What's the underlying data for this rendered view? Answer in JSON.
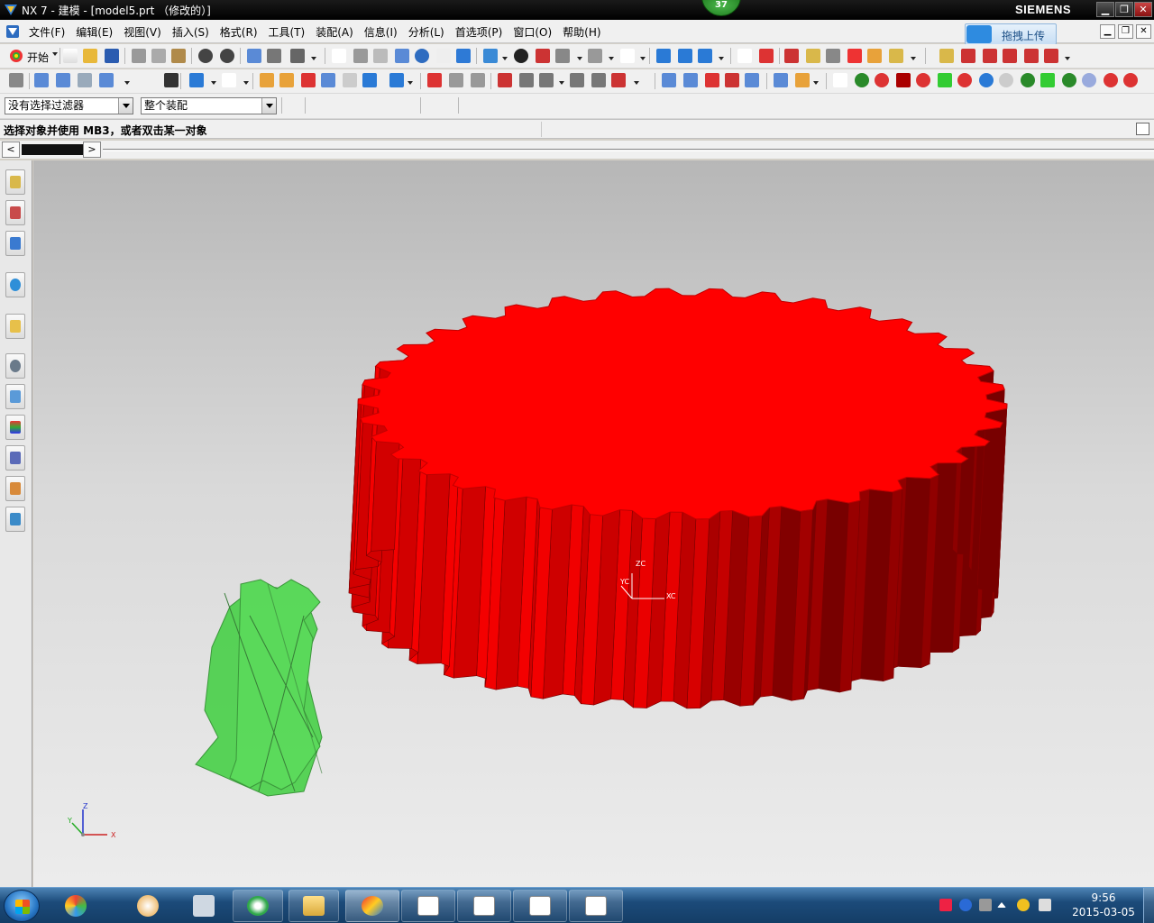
{
  "window": {
    "title": "NX 7 - 建模 - [model5.prt （修改的）]",
    "brand": "SIEMENS",
    "badge": "37",
    "controls": {
      "minimize": "▁",
      "restore": "❐",
      "close": "✕"
    }
  },
  "menubar": {
    "items": [
      "文件(F)",
      "编辑(E)",
      "视图(V)",
      "插入(S)",
      "格式(R)",
      "工具(T)",
      "装配(A)",
      "信息(I)",
      "分析(L)",
      "首选项(P)",
      "窗口(O)",
      "帮助(H)"
    ],
    "upload_label": "拖拽上传"
  },
  "toolbar": {
    "start_label": "开始",
    "start_icon": "start-icon"
  },
  "filters": {
    "type_filter": "没有选择过滤器",
    "scope_filter": "整个装配"
  },
  "prompt": {
    "text": "选择对象并使用 MB3，或者双击某一对象"
  },
  "viewport": {
    "gear_color": "#ff0000",
    "pinion_color": "#33cc33",
    "background_top": "#b7b7b7",
    "background_bottom": "#ececec",
    "wcs_labels": {
      "zc": "ZC",
      "yc": "YC",
      "xc": "XC"
    },
    "triad_labels": {
      "z": "Z",
      "y": "Y",
      "x": "X"
    }
  },
  "taskbar": {
    "time": "9:56",
    "date": "2015-03-05"
  }
}
